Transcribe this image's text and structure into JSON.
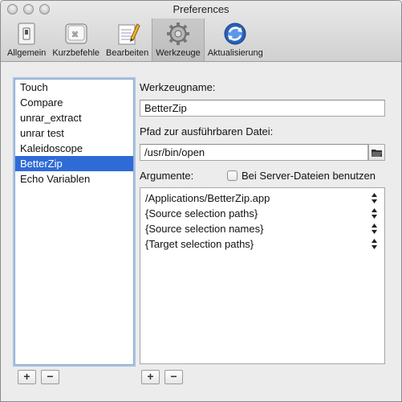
{
  "window": {
    "title": "Preferences"
  },
  "toolbar": {
    "items": [
      {
        "label": "Allgemein"
      },
      {
        "label": "Kurzbefehle"
      },
      {
        "label": "Bearbeiten"
      },
      {
        "label": "Werkzeuge",
        "selected": true
      },
      {
        "label": "Aktualisierung"
      }
    ]
  },
  "tools": {
    "items": [
      "Touch",
      "Compare",
      "unrar_extract",
      "unrar test",
      "Kaleidoscope",
      "BetterZip",
      "Echo Variablen"
    ],
    "selected": "BetterZip",
    "add_label": "+",
    "remove_label": "−"
  },
  "form": {
    "name_label": "Werkzeugname:",
    "name_value": "BetterZip",
    "path_label": "Pfad zur ausführbaren Datei:",
    "path_value": "/usr/bin/open",
    "args_label": "Argumente:",
    "server_checkbox_label": "Bei Server-Dateien benutzen",
    "server_checkbox_checked": false,
    "arguments": [
      "/Applications/BetterZip.app",
      "{Source selection paths}",
      "{Source selection names}",
      "{Target selection paths}"
    ],
    "add_label": "+",
    "remove_label": "−"
  },
  "colors": {
    "selection": "#2f6bd6",
    "focus_ring": "#a9c3e6"
  }
}
